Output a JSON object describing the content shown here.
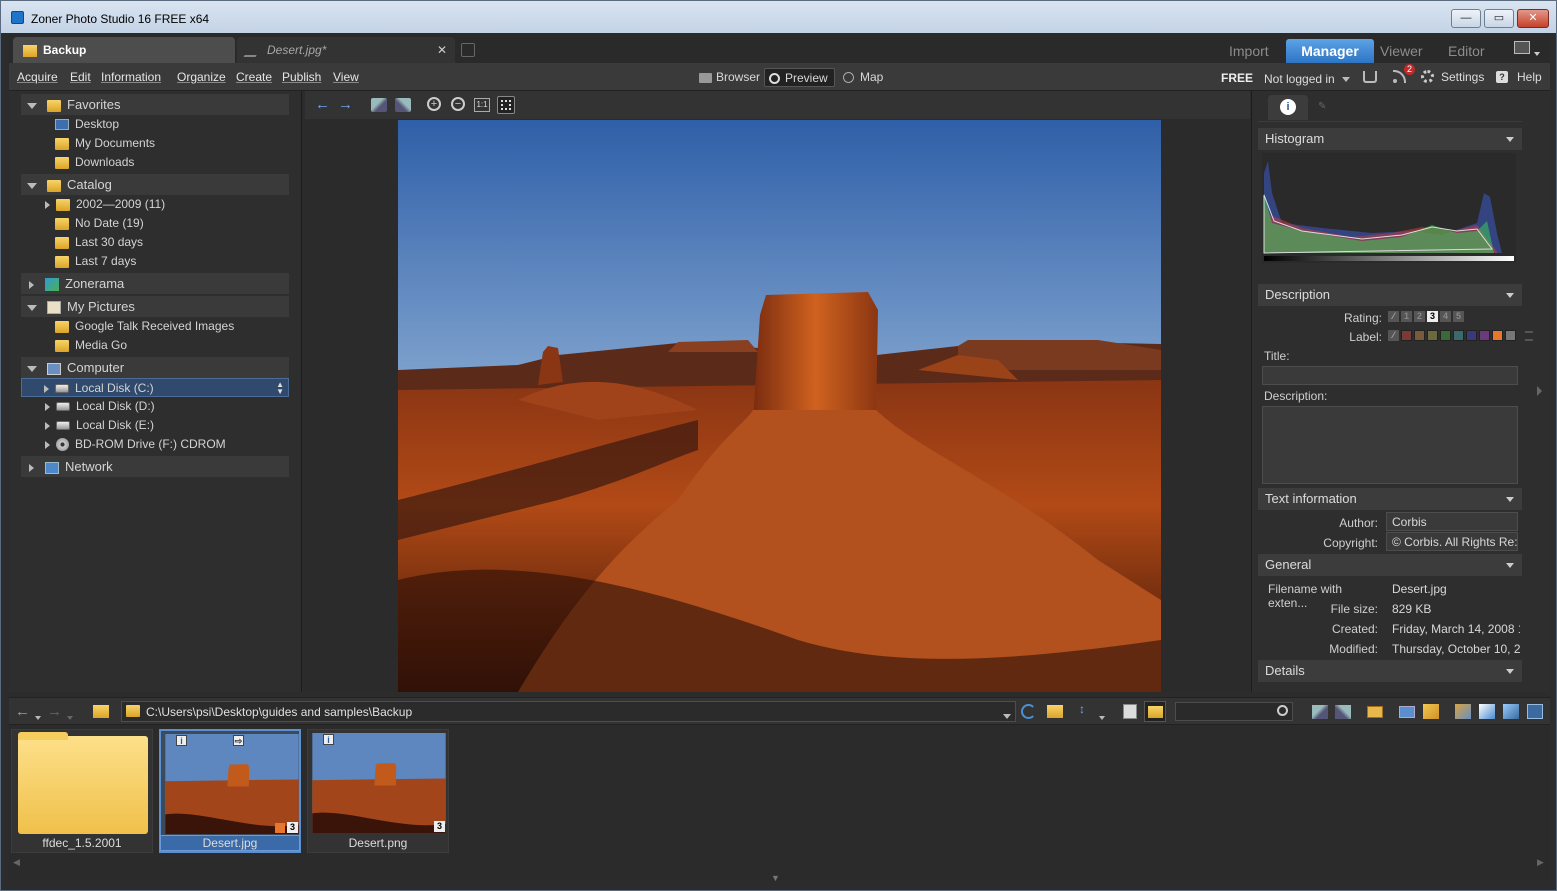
{
  "window": {
    "title": "Zoner Photo Studio 16 FREE x64",
    "controls": {
      "minimize": "—",
      "maximize": "▭",
      "close": "✕"
    }
  },
  "tabs": {
    "docs": [
      {
        "label": "Backup",
        "active": true
      },
      {
        "label": "Desert.jpg*",
        "active": false,
        "close": "✕"
      }
    ],
    "modes": [
      {
        "label": "Import",
        "active": false
      },
      {
        "label": "Manager",
        "active": true
      },
      {
        "label": "Viewer",
        "active": false
      },
      {
        "label": "Editor",
        "active": false
      }
    ]
  },
  "menu": {
    "items": [
      "Acquire",
      "Edit",
      "Information",
      "Organize",
      "Create",
      "Publish",
      "View"
    ],
    "views": {
      "browser": "Browser",
      "preview": "Preview",
      "map": "Map"
    },
    "free": "FREE",
    "login": "Not logged in",
    "rss_badge": "2",
    "settings": "Settings",
    "help": "Help"
  },
  "tree": {
    "favorites": {
      "label": "Favorites",
      "items": [
        "Desktop",
        "My Documents",
        "Downloads"
      ]
    },
    "catalog": {
      "label": "Catalog",
      "items": [
        "2002—2009 (11)",
        "No Date (19)",
        "Last 30 days",
        "Last 7 days"
      ]
    },
    "zonerama": {
      "label": "Zonerama"
    },
    "mypictures": {
      "label": "My Pictures",
      "items": [
        "Google Talk Received Images",
        "Media Go"
      ]
    },
    "computer": {
      "label": "Computer",
      "items": [
        "Local Disk (C:)",
        "Local Disk (D:)",
        "Local Disk (E:)",
        "BD-ROM Drive (F:) CDROM"
      ]
    },
    "network": {
      "label": "Network"
    }
  },
  "viewer": {
    "zoom_1to1": "1:1"
  },
  "info_panel": {
    "histogram": "Histogram",
    "description": {
      "header": "Description",
      "rating_label": "Rating:",
      "rating_values": [
        "1",
        "2",
        "3",
        "4",
        "5"
      ],
      "rating_selected": 3,
      "label_label": "Label:",
      "label_colors": [
        "#7a3a3a",
        "#7a5a3a",
        "#6a6a3a",
        "#3a6a3a",
        "#3a6a6a",
        "#3a3a7a",
        "#6a3a7a",
        "#e8762c",
        "#777777"
      ],
      "title_label": "Title:",
      "title_value": "",
      "desc_label": "Description:",
      "desc_value": ""
    },
    "text_info": {
      "header": "Text information",
      "author_label": "Author:",
      "author_value": "Corbis",
      "copyright_label": "Copyright:",
      "copyright_value": "© Corbis.  All Rights Re:"
    },
    "general": {
      "header": "General",
      "rows": [
        {
          "label": "Filename with exten...",
          "value": "Desert.jpg"
        },
        {
          "label": "File size:",
          "value": "829 KB"
        },
        {
          "label": "Created:",
          "value": "Friday, March 14, 2008 1"
        },
        {
          "label": "Modified:",
          "value": "Thursday, October 10, 2"
        }
      ]
    },
    "details": {
      "header": "Details"
    }
  },
  "pathbar": {
    "path": "C:\\Users\\psi\\Desktop\\guides and samples\\Backup",
    "search_placeholder": ""
  },
  "filmstrip": {
    "items": [
      {
        "label": "ffdec_1.5.2001",
        "type": "folder"
      },
      {
        "label": "Desert.jpg",
        "type": "image",
        "selected": true,
        "rating": "3",
        "color_label": "#e8762c"
      },
      {
        "label": "Desert.png",
        "type": "image",
        "selected": false,
        "rating": "3"
      }
    ]
  },
  "colors": {
    "accent": "#3a86d6",
    "panel": "#2e2e2e",
    "selection": "#2f4a6d"
  }
}
